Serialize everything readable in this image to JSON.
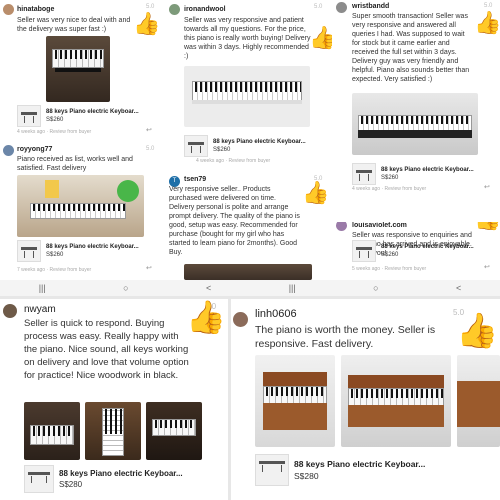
{
  "rating_label": "5.0",
  "thumb": "👍",
  "reply_icon": "↩",
  "product": {
    "title": "88 keys Piano electric Keyboar...",
    "price_small": "S$260",
    "price_large": "S$280"
  },
  "reviews": [
    {
      "user": "hinataboge",
      "text": "Seller was very nice to deal with and the delivery was super fast :)",
      "meta": "4 weeks ago · Review from buyer"
    },
    {
      "user": "ironandwool",
      "text": "Seller was very responsive and patient towards all my questions. For the price, this piano is really worth buying! Delivery was within 3 days. Highly recommended :)",
      "meta": "4 weeks ago · Review from buyer"
    },
    {
      "user": "wristbandd",
      "text": "Super smooth transaction! Seller was very responsive and answered all queries I had. Was supposed to wait for stock but it came earlier and received the full set within 3 days. Delivery guy was very friendly and helpful. Piano also sounds better than expected. Very satisfied :)",
      "meta": "4 weeks ago · Review from buyer"
    },
    {
      "user": "royyong77",
      "text": "Piano received as list, works well and satisfied. Fast delivery",
      "meta": "7 weeks ago · Review from buyer"
    },
    {
      "user": "tsen79",
      "avatar_letter": "T",
      "text": "Very responsive seller.. Products purchased were delivered on time. Delivery personal is polite and arrange prompt delivery. The quality of the piano is good, setup was easy. Recommended for purchase (bought for my girl who has started to learn piano for 2months). Good Buy.",
      "meta": ""
    },
    {
      "user": "louisaviolet.com",
      "text": "Seller was responsive to enquiries and the piano has arrived and is enjoyable. Thank you!",
      "meta": "5 weeks ago · Review from buyer"
    },
    {
      "user": "nwyam",
      "text": "Seller is quick to respond. Buying process was easy. Really happy with the piano. Nice sound, all keys working on delivery and love that volume option for practice! Nice woodwork in black."
    },
    {
      "user": "linh0606",
      "text": "The piano is worth the money. Seller is responsive. Fast delivery."
    }
  ],
  "nav": {
    "recent": "|||",
    "home": "○",
    "back": "<"
  },
  "colors": {
    "thumb": "#f5b921",
    "bg": "#ffffff"
  }
}
